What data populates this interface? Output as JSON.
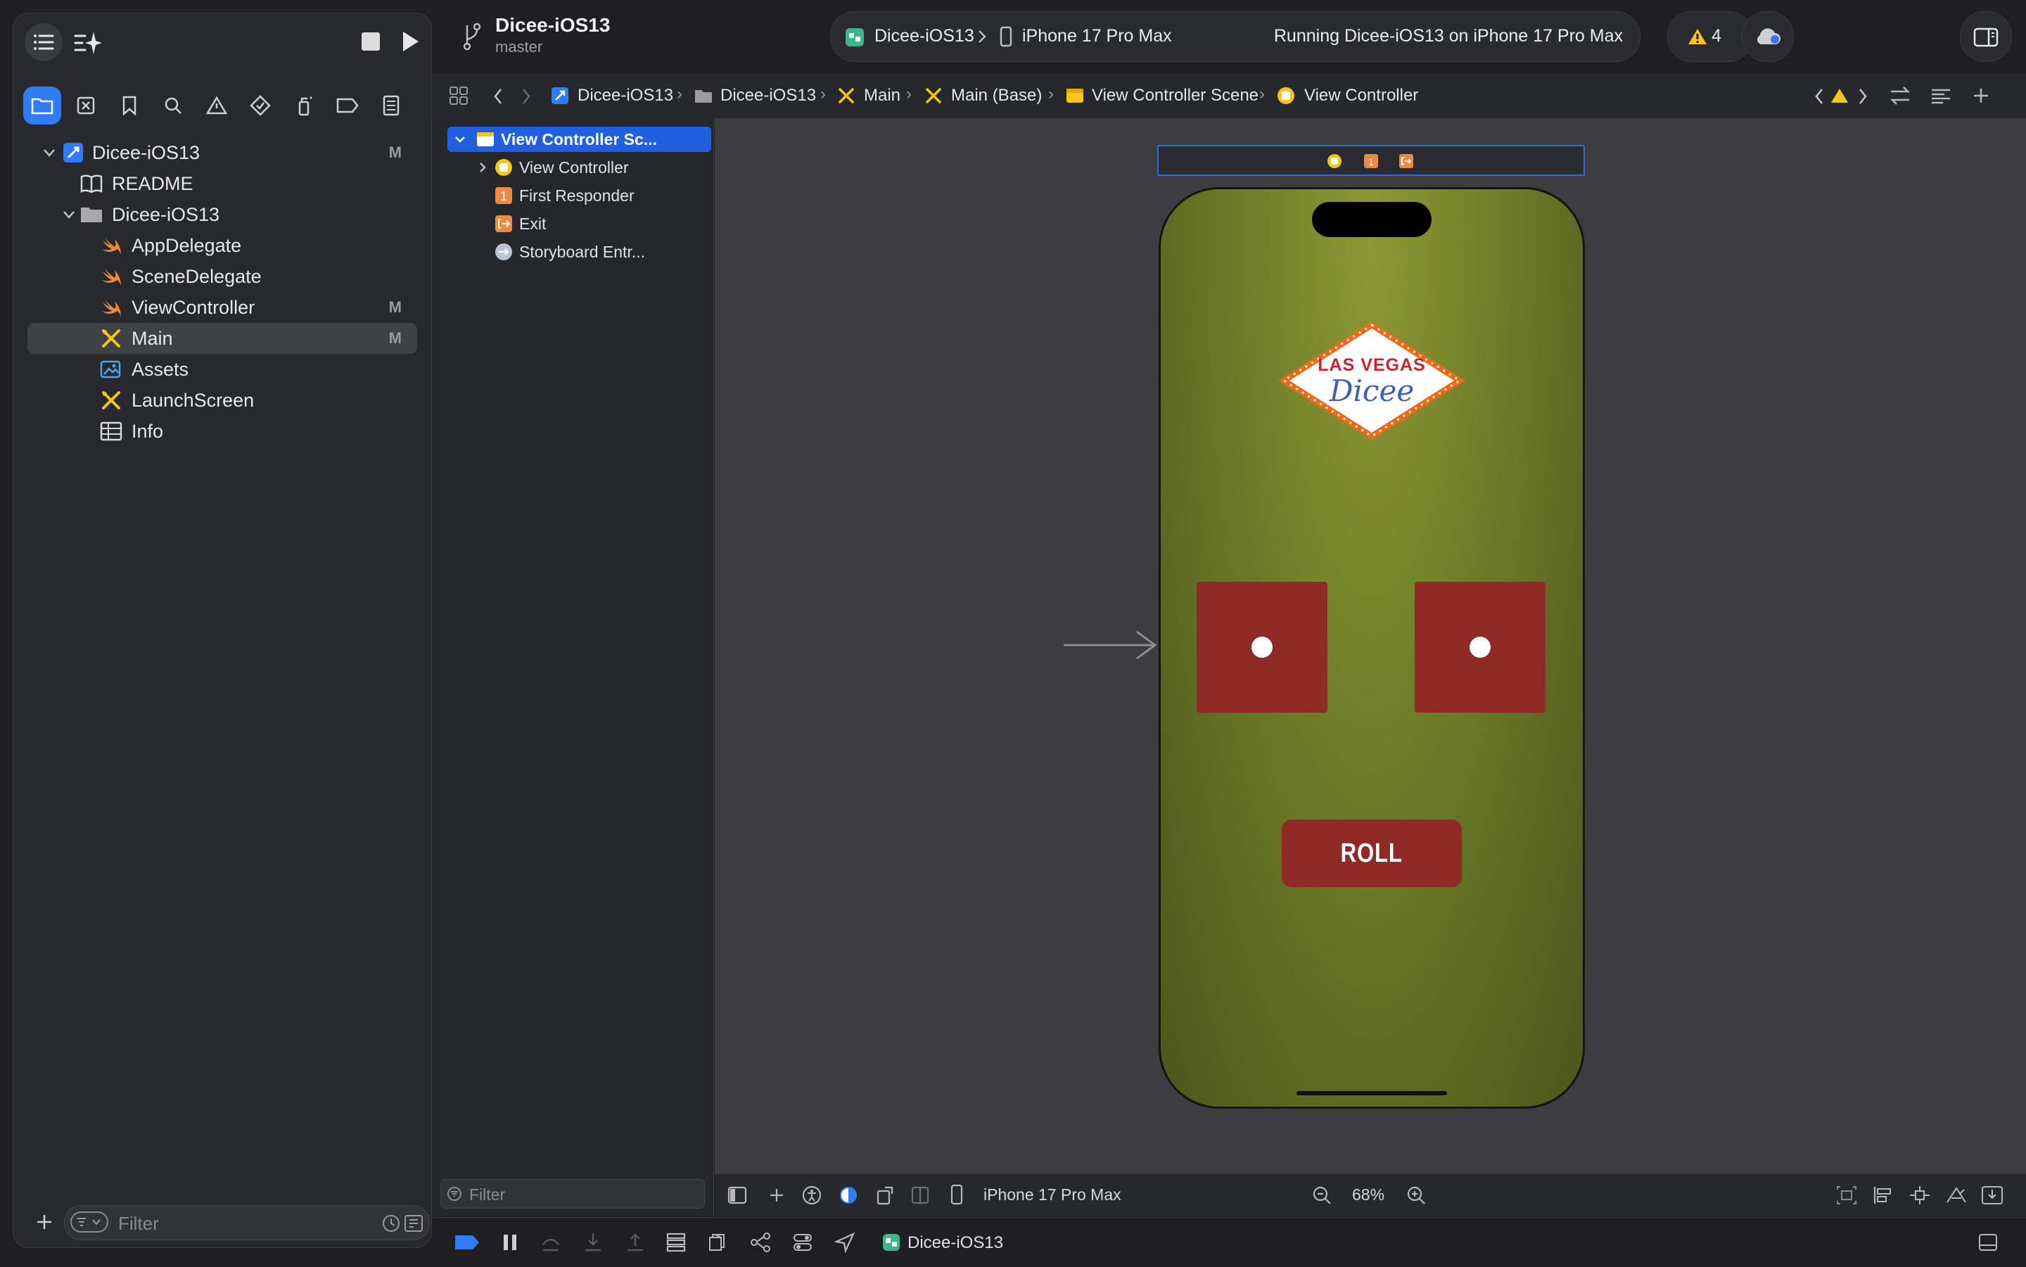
{
  "toolbar": {
    "project_title": "Dicee-iOS13",
    "branch": "master",
    "scheme": "Dicee-iOS13",
    "device": "iPhone 17 Pro Max",
    "status": "Running Dicee-iOS13 on iPhone 17 Pro Max",
    "warning_count": "4"
  },
  "jumpbar": {
    "items": [
      "Dicee-iOS13",
      "Dicee-iOS13",
      "Main",
      "Main (Base)",
      "View Controller Scene",
      "View Controller"
    ]
  },
  "navigator": {
    "items": [
      {
        "label": "Dicee-iOS13",
        "badge": "M"
      },
      {
        "label": "README",
        "badge": ""
      },
      {
        "label": "Dicee-iOS13",
        "badge": ""
      },
      {
        "label": "AppDelegate",
        "badge": ""
      },
      {
        "label": "SceneDelegate",
        "badge": ""
      },
      {
        "label": "ViewController",
        "badge": "M"
      },
      {
        "label": "Main",
        "badge": "M"
      },
      {
        "label": "Assets",
        "badge": ""
      },
      {
        "label": "LaunchScreen",
        "badge": ""
      },
      {
        "label": "Info",
        "badge": ""
      }
    ],
    "filter_placeholder": "Filter"
  },
  "outline": {
    "items": [
      "View Controller Sc...",
      "View Controller",
      "First Responder",
      "Exit",
      "Storyboard Entr..."
    ],
    "filter_placeholder": "Filter"
  },
  "phone": {
    "sign_line1": "LAS VEGAS",
    "sign_line2": "Dicee",
    "roll_label": "ROLL"
  },
  "canvas_bar": {
    "device": "iPhone 17 Pro Max",
    "zoom": "68%"
  },
  "debug_bar": {
    "target": "Dicee-iOS13"
  },
  "colors": {
    "accent": "#2f7cf6",
    "dice": "#8f2a26",
    "felt": "#6f7d28",
    "warning": "#f5c518"
  }
}
